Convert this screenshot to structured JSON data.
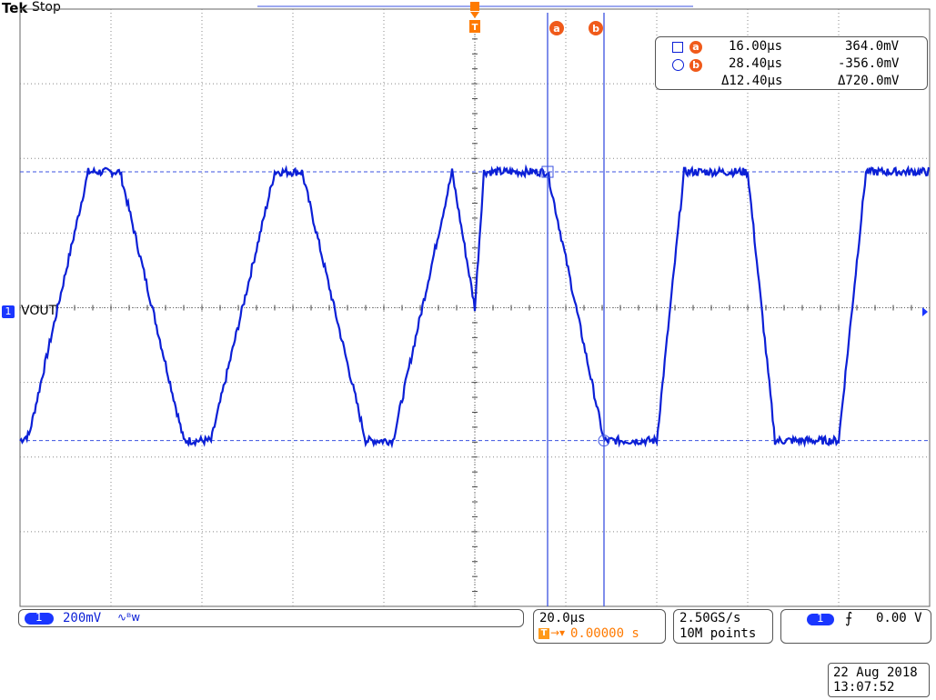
{
  "brand": "Tek",
  "run_state": "Stop",
  "channel": {
    "label": "VOUT",
    "number": "1",
    "scale": "200mV",
    "coupling_icon": "bandwidth-limit-icon",
    "color": "#0b1fd6"
  },
  "cursors": {
    "a": {
      "badge": "a",
      "time": "16.00µs",
      "voltage": "364.0mV"
    },
    "b": {
      "badge": "b",
      "time": "28.40µs",
      "voltage": "-356.0mV"
    },
    "delta": {
      "time": "Δ12.40µs",
      "voltage": "Δ720.0mV"
    }
  },
  "trigger": {
    "marker": "T",
    "position": "0.00000 s",
    "source": "1",
    "slope_icon": "rising-edge-icon",
    "level": "0.00 V"
  },
  "horizontal": {
    "scale": "20.0µs"
  },
  "acquisition": {
    "sample_rate": "2.50GS/s",
    "record_length": "10M points"
  },
  "datetime": {
    "date": "22 Aug 2018",
    "time": "13:07:52"
  },
  "colors": {
    "trace": "#0b1fd6",
    "cursor": "#3b52e0",
    "accent": "#ff7a00",
    "badge": "#f05a1a",
    "channel_pill": "#1a36ff"
  },
  "chart_data": {
    "type": "line",
    "xlabel": "",
    "ylabel": "",
    "x_units": "µs",
    "y_units": "mV",
    "x_range": [
      -100,
      100
    ],
    "y_range": [
      -800,
      800
    ],
    "grid": true,
    "series": [
      {
        "name": "VOUT",
        "x": [
          -100,
          -98,
          -85,
          -78,
          -64,
          -58,
          -44,
          -38,
          -24,
          -18,
          -5,
          0,
          2,
          16,
          28.4,
          40,
          46,
          60,
          66,
          80,
          86,
          100
        ],
        "y": [
          -356,
          -340,
          364,
          364,
          -356,
          -356,
          364,
          364,
          -356,
          -356,
          364,
          0,
          364,
          364,
          -356,
          -356,
          364,
          364,
          -356,
          -356,
          364,
          364
        ]
      }
    ]
  }
}
